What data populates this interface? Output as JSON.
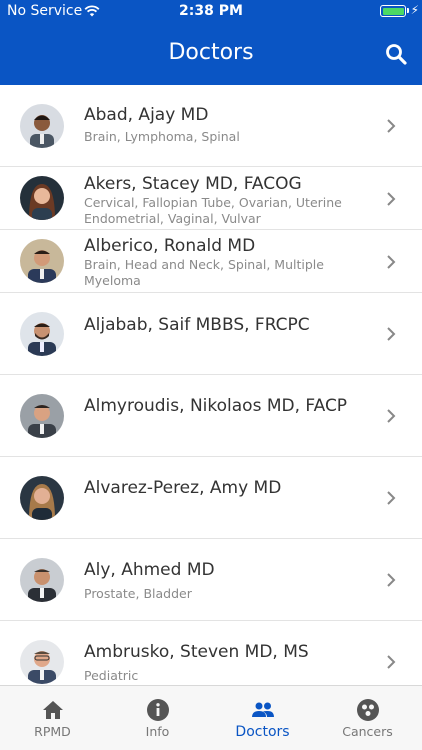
{
  "status_bar": {
    "carrier": "No Service",
    "time": "2:38 PM"
  },
  "header": {
    "title": "Doctors"
  },
  "doctors": [
    {
      "name": "Abad, Ajay MD",
      "specialties": "Brain, Lymphoma, Spinal"
    },
    {
      "name": "Akers, Stacey MD, FACOG",
      "specialties": "Cervical, Fallopian Tube, Ovarian, Uterine Endometrial, Vaginal, Vulvar"
    },
    {
      "name": "Alberico, Ronald MD",
      "specialties": "Brain, Head and Neck, Spinal, Multiple Myeloma"
    },
    {
      "name": "Aljabab, Saif MBBS, FRCPC",
      "specialties": ""
    },
    {
      "name": "Almyroudis, Nikolaos MD, FACP",
      "specialties": ""
    },
    {
      "name": "Alvarez-Perez, Amy MD",
      "specialties": ""
    },
    {
      "name": "Aly, Ahmed MD",
      "specialties": "Prostate, Bladder"
    },
    {
      "name": "Ambrusko, Steven MD, MS",
      "specialties": "Pediatric"
    }
  ],
  "tabs": [
    {
      "label": "RPMD",
      "icon": "home-icon"
    },
    {
      "label": "Info",
      "icon": "info-icon"
    },
    {
      "label": "Doctors",
      "icon": "people-icon"
    },
    {
      "label": "Cancers",
      "icon": "cancers-icon"
    }
  ],
  "colors": {
    "brand": "#0a55c4",
    "battery": "#4cd964"
  }
}
